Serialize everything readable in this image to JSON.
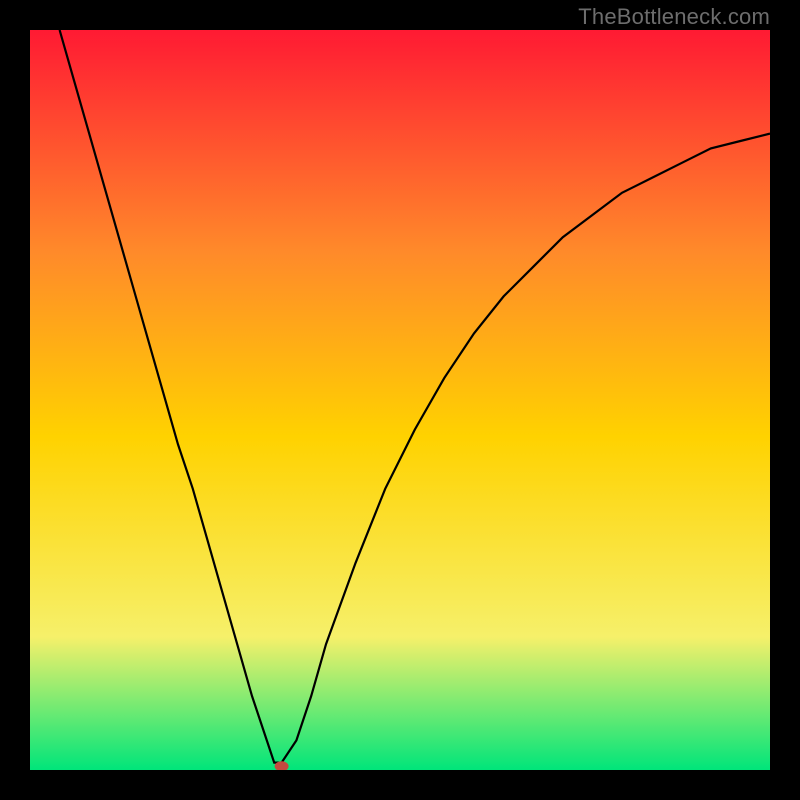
{
  "watermark": "TheBottleneck.com",
  "chart_data": {
    "type": "line",
    "title": "",
    "xlabel": "",
    "ylabel": "",
    "xlim": [
      0,
      100
    ],
    "ylim": [
      0,
      100
    ],
    "background_gradient": {
      "top": "#FF1A33",
      "mid_upper": "#FF8A2A",
      "mid": "#FFD200",
      "mid_lower": "#F6F06A",
      "bottom": "#00E57A"
    },
    "series": [
      {
        "name": "bottleneck-curve",
        "x": [
          4,
          6,
          8,
          10,
          12,
          14,
          16,
          18,
          20,
          22,
          24,
          26,
          28,
          30,
          32,
          33,
          34,
          36,
          38,
          40,
          44,
          48,
          52,
          56,
          60,
          64,
          68,
          72,
          76,
          80,
          84,
          88,
          92,
          96,
          100
        ],
        "y": [
          100,
          93,
          86,
          79,
          72,
          65,
          58,
          51,
          44,
          38,
          31,
          24,
          17,
          10,
          4,
          1,
          1,
          4,
          10,
          17,
          28,
          38,
          46,
          53,
          59,
          64,
          68,
          72,
          75,
          78,
          80,
          82,
          84,
          85,
          86
        ]
      }
    ],
    "marker": {
      "x": 34,
      "y": 0.5,
      "color": "#C24A3F"
    }
  }
}
